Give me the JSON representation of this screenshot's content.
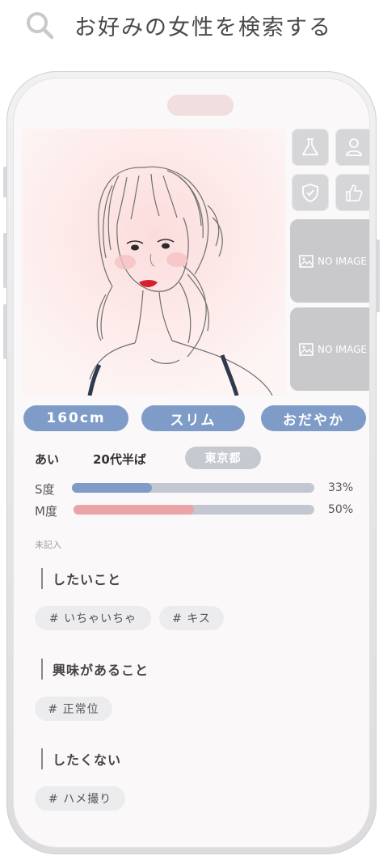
{
  "header": {
    "title": "お好みの女性を検索する"
  },
  "icons": {
    "search": "search-icon",
    "flask": "flask-icon",
    "person": "person-icon",
    "shield": "shield-check-icon",
    "thumb": "thumbs-up-icon",
    "image": "image-icon"
  },
  "photos": {
    "no_image_1": "NO IMAGE",
    "no_image_2": "NO IMAGE"
  },
  "attributes": {
    "height": "160cm",
    "body_type": "スリム",
    "personality": "おだやか"
  },
  "profile": {
    "name": "あい",
    "age": "20代半ば",
    "location": "東京都"
  },
  "sm": {
    "s_label": "S度",
    "s_value": 0.33,
    "s_text": "33%",
    "m_label": "M度",
    "m_value": 0.5,
    "m_text": "50%",
    "s_color": "#7f9cc8",
    "m_color": "#eba4a6"
  },
  "note": "未記入",
  "sections": {
    "want": {
      "title": "したいこと",
      "tags": [
        "# いちゃいちゃ",
        "# キス"
      ]
    },
    "interest": {
      "title": "興味があること",
      "tags": [
        "# 正常位"
      ]
    },
    "dont": {
      "title": "したくない",
      "tags": [
        "# ハメ撮り"
      ]
    }
  },
  "colors": {
    "accent": "#7f9cc8",
    "pink": "#eba4a6",
    "location_badge": "#c6c9cf"
  }
}
